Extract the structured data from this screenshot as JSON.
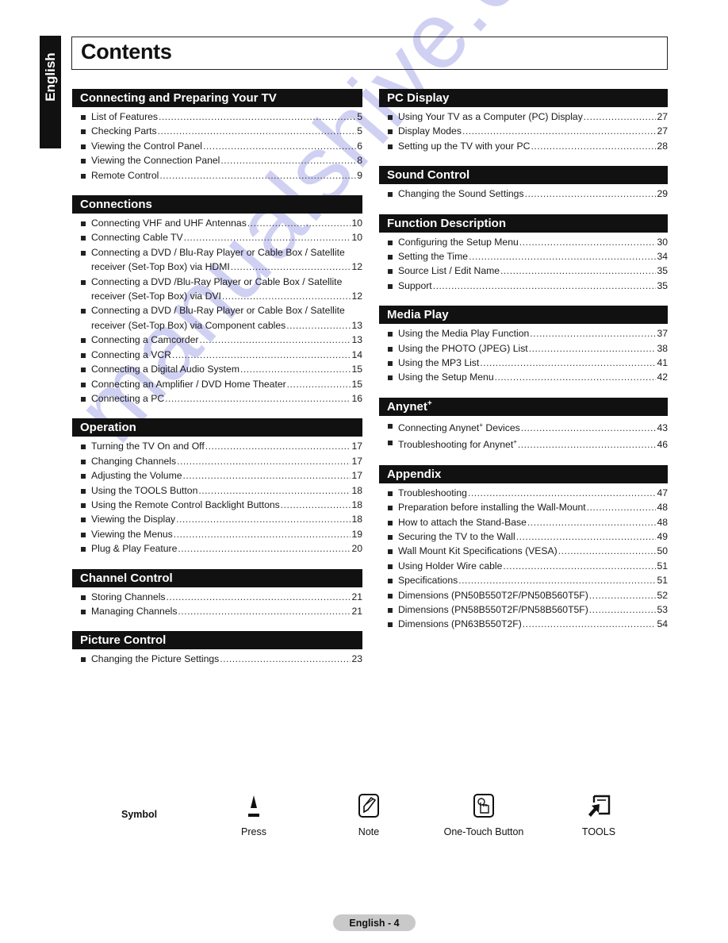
{
  "language_tab": "English",
  "title": "Contents",
  "left_column": [
    {
      "heading": "Connecting and Preparing Your TV",
      "items": [
        {
          "text": "List of Features",
          "page": "5"
        },
        {
          "text": "Checking Parts",
          "page": "5"
        },
        {
          "text": "Viewing the Control Panel",
          "page": "6"
        },
        {
          "text": "Viewing the Connection Panel",
          "page": "8"
        },
        {
          "text": "Remote Control",
          "page": "9"
        }
      ]
    },
    {
      "heading": "Connections",
      "items": [
        {
          "text": "Connecting VHF and UHF Antennas",
          "page": "10"
        },
        {
          "text": "Connecting Cable TV",
          "page": "10"
        },
        {
          "line1": "Connecting a DVD / Blu-Ray Player or Cable Box / Satellite",
          "text": "receiver (Set-Top Box) via HDMI",
          "page": "12"
        },
        {
          "line1": "Connecting a DVD /Blu-Ray Player or Cable Box / Satellite",
          "text": "receiver (Set-Top Box) via DVI",
          "page": "12"
        },
        {
          "line1": "Connecting a DVD / Blu-Ray Player or Cable Box / Satellite",
          "text": "receiver (Set-Top Box) via Component cables",
          "page": "13"
        },
        {
          "text": "Connecting a Camcorder",
          "page": "13"
        },
        {
          "text": "Connecting a VCR",
          "page": "14"
        },
        {
          "text": "Connecting a Digital Audio System",
          "page": "15"
        },
        {
          "text": "Connecting an Amplifier / DVD Home Theater",
          "page": "15"
        },
        {
          "text": "Connecting a PC",
          "page": "16"
        }
      ]
    },
    {
      "heading": "Operation",
      "items": [
        {
          "text": "Turning the TV On and Off",
          "page": "17"
        },
        {
          "text": "Changing Channels",
          "page": "17"
        },
        {
          "text": "Adjusting the Volume",
          "page": "17"
        },
        {
          "text": "Using the TOOLS Button",
          "page": "18"
        },
        {
          "text": "Using the Remote Control Backlight Buttons",
          "page": "18"
        },
        {
          "text": "Viewing the Display",
          "page": "18"
        },
        {
          "text": "Viewing the Menus",
          "page": "19"
        },
        {
          "text": "Plug & Play Feature",
          "page": "20"
        }
      ]
    },
    {
      "heading": "Channel Control",
      "items": [
        {
          "text": "Storing Channels",
          "page": "21"
        },
        {
          "text": "Managing Channels",
          "page": "21"
        }
      ]
    },
    {
      "heading": "Picture Control",
      "items": [
        {
          "text": "Changing the Picture Settings",
          "page": "23"
        }
      ]
    }
  ],
  "right_column": [
    {
      "heading": "PC Display",
      "items": [
        {
          "text": "Using Your TV as a Computer (PC) Display",
          "page": "27"
        },
        {
          "text": "Display Modes",
          "page": "27"
        },
        {
          "text": "Setting up the TV with your PC",
          "page": "28"
        }
      ]
    },
    {
      "heading": "Sound Control",
      "items": [
        {
          "text": "Changing the Sound Settings",
          "page": "29"
        }
      ]
    },
    {
      "heading": "Function Description",
      "items": [
        {
          "text": "Configuring the Setup Menu",
          "page": "30"
        },
        {
          "text": "Setting the Time",
          "page": "34"
        },
        {
          "text": "Source List / Edit Name",
          "page": "35"
        },
        {
          "text": "Support",
          "page": "35"
        }
      ]
    },
    {
      "heading": "Media Play",
      "items": [
        {
          "text": "Using the Media Play Function",
          "page": "37"
        },
        {
          "text": "Using the PHOTO (JPEG) List",
          "page": "38"
        },
        {
          "text": "Using the MP3 List",
          "page": "41"
        },
        {
          "text": "Using the Setup Menu",
          "page": "42"
        }
      ]
    },
    {
      "heading": "Anynet",
      "heading_sup": "+",
      "items": [
        {
          "text": "Connecting Anynet",
          "sup": "+",
          "after": " Devices",
          "page": "43"
        },
        {
          "text": "Troubleshooting for Anynet",
          "sup": "+",
          "after": "",
          "page": "46"
        }
      ]
    },
    {
      "heading": "Appendix",
      "items": [
        {
          "text": "Troubleshooting",
          "page": "47"
        },
        {
          "text": "Preparation before installing the Wall-Mount",
          "page": "48"
        },
        {
          "text": "How to attach the Stand-Base",
          "page": "48"
        },
        {
          "text": "Securing the TV to the Wall",
          "page": "49"
        },
        {
          "text": "Wall Mount Kit Specifications (VESA)",
          "page": "50"
        },
        {
          "text": "Using Holder Wire cable",
          "page": "51"
        },
        {
          "text": "Specifications",
          "page": "51"
        },
        {
          "text": "Dimensions (PN50B550T2F/PN50B560T5F)",
          "page": "52"
        },
        {
          "text": "Dimensions (PN58B550T2F/PN58B560T5F)",
          "page": "53"
        },
        {
          "text": "Dimensions (PN63B550T2F)",
          "page": "54"
        }
      ]
    }
  ],
  "symbols": {
    "label": "Symbol",
    "items": [
      {
        "icon": "press-icon",
        "label": "Press"
      },
      {
        "icon": "note-icon",
        "label": "Note"
      },
      {
        "icon": "one-touch-button-icon",
        "label": "One-Touch Button"
      },
      {
        "icon": "tools-icon",
        "label": "TOOLS"
      }
    ]
  },
  "footer": {
    "page_label": "English - 4"
  },
  "watermark": "manualshive.com"
}
